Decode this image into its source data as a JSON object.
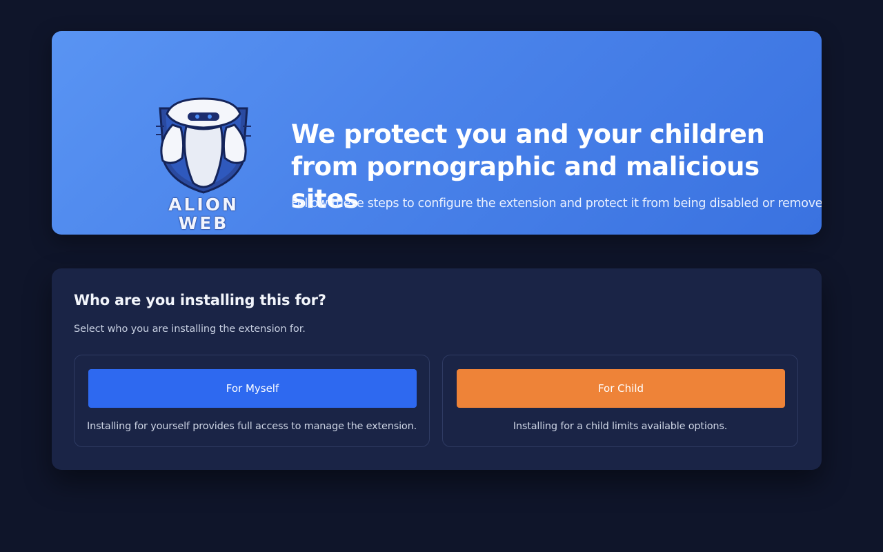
{
  "hero": {
    "logo_line1": "ALION",
    "logo_line2": "WEB",
    "title": "We protect you and your children from pornographic and malicious sites",
    "subtitle": "Follow these steps to configure the extension and protect it from being disabled or removed."
  },
  "setup": {
    "title": "Who are you installing this for?",
    "subtitle": "Select who you are installing the extension for.",
    "options": [
      {
        "button_label": "For Myself",
        "description": "Installing for yourself provides full access to manage the extension."
      },
      {
        "button_label": "For Child",
        "description": "Installing for a child limits available options."
      }
    ]
  },
  "colors": {
    "background": "#0f152a",
    "hero_gradient_start": "#5994f3",
    "hero_gradient_end": "#3a72e0",
    "card_bg": "#1a2446",
    "button_myself": "#2e69f0",
    "button_child": "#ee8338"
  },
  "icons": {
    "logo": "alion-web-robot-shield-logo"
  }
}
